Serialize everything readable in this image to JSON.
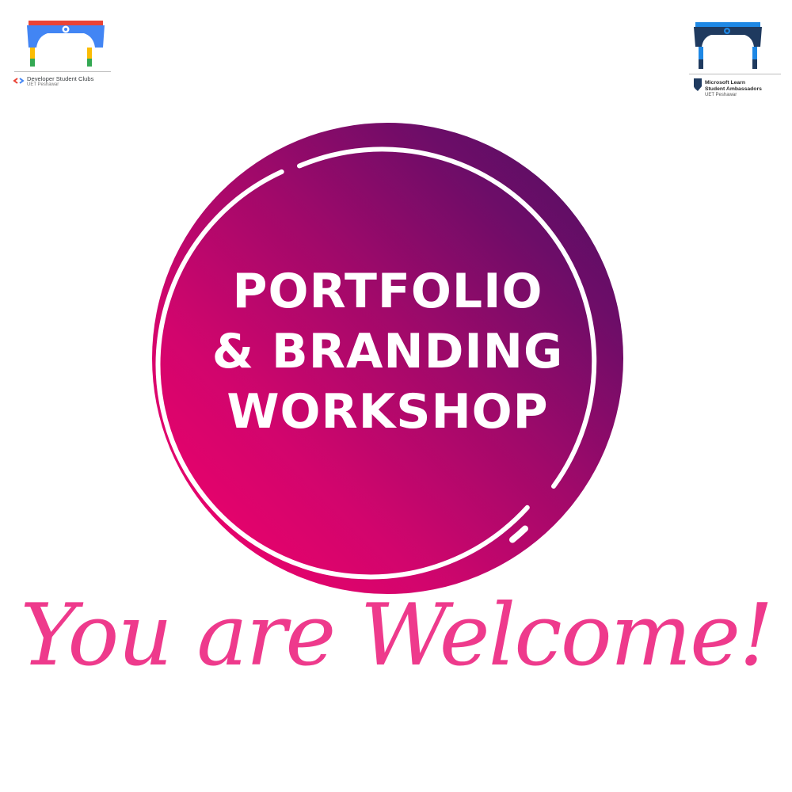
{
  "logos": {
    "left": {
      "line1": "Developer Student Clubs",
      "line2": "UET Peshawar"
    },
    "right": {
      "line1": "Microsoft Learn",
      "line2": "Student Ambassadors",
      "line3": "UET Peshawar"
    }
  },
  "title": {
    "line1": "PORTFOLIO",
    "line2": "& BRANDING",
    "line3": "WORKSHOP"
  },
  "welcome": "You are Welcome!",
  "colors": {
    "gradient_start": "#f5006a",
    "gradient_end": "#4b0f62",
    "script": "#ee3a8c",
    "dsc_blue": "#4285f4",
    "dsc_red": "#ea4335",
    "dsc_green": "#34a853",
    "dsc_yellow": "#fbbc04",
    "msla_navy": "#1f3a5f",
    "msla_blue": "#1e88e5"
  },
  "icons": [
    "gear-icon",
    "archway-logo",
    "code-brackets-icon",
    "shield-badge-icon"
  ]
}
